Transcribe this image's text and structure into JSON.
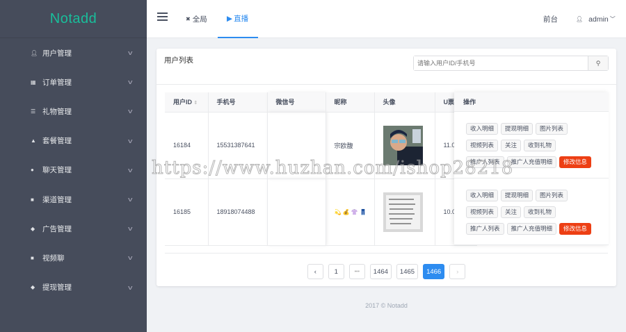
{
  "brand": "Notadd",
  "sidebar": {
    "items": [
      {
        "label": "用户管理",
        "icon": "user-icon"
      },
      {
        "label": "订单管理",
        "icon": "list-icon"
      },
      {
        "label": "礼物管理",
        "icon": "server-icon"
      },
      {
        "label": "套餐管理",
        "icon": "flask-icon"
      },
      {
        "label": "聊天管理",
        "icon": "chat-icon"
      },
      {
        "label": "渠道管理",
        "icon": "folder-icon"
      },
      {
        "label": "广告管理",
        "icon": "tag-icon"
      },
      {
        "label": "视频聊",
        "icon": "folder-icon"
      },
      {
        "label": "提现管理",
        "icon": "tag-icon"
      }
    ]
  },
  "header": {
    "nav": [
      {
        "label": "全局",
        "icon": "✖"
      },
      {
        "label": "直播",
        "icon": "▶"
      }
    ],
    "front": "前台",
    "user": "admin"
  },
  "card": {
    "title": "用户列表",
    "search_placeholder": "请输入用户ID/手机号"
  },
  "table": {
    "columns": [
      "用户ID",
      "手机号",
      "微信号",
      "昵称",
      "头像",
      "U票",
      "操作"
    ],
    "rows": [
      {
        "id": "16184",
        "phone": "15531387641",
        "wechat": "",
        "nickname": "宗欧馥",
        "uticket": "11.0"
      },
      {
        "id": "16185",
        "phone": "18918074488",
        "wechat": "",
        "nickname": "💫 💰 👚 👖",
        "uticket": "10.0"
      }
    ],
    "actions": [
      "收入明细",
      "提现明细",
      "图片列表",
      "视频列表",
      "关注",
      "收到礼物",
      "推广人列表",
      "推广人充值明细",
      "修改信息"
    ]
  },
  "pagination": {
    "pages": [
      "1",
      "•••",
      "1464",
      "1465",
      "1466"
    ],
    "current": "1466"
  },
  "footer": "2017 © Notadd",
  "watermark": "https://www.huzhan.com/ishop28218",
  "colors": {
    "sidebar": "#464c5b",
    "brand": "#19be9b",
    "primary": "#2d8cf0",
    "danger": "#ed3f14"
  }
}
